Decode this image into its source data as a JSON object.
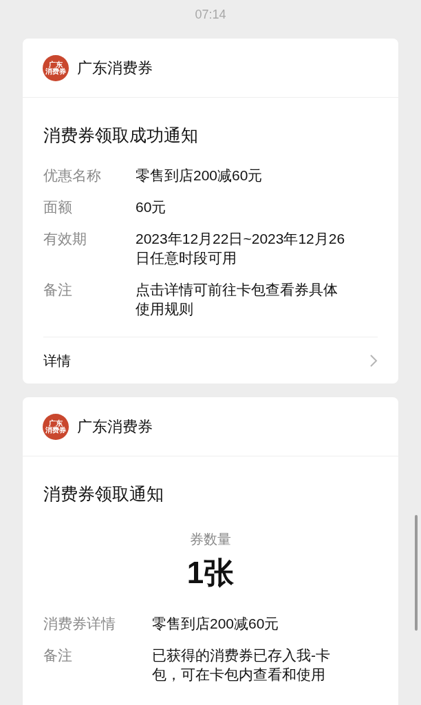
{
  "time": "07:14",
  "messages": [
    {
      "sender": {
        "name": "广东消费券",
        "avatar_text": [
          "广东",
          "消费券"
        ]
      },
      "title": "消费券领取成功通知",
      "rows": [
        {
          "label": "优惠名称",
          "value": "零售到店200减60元"
        },
        {
          "label": "面额",
          "value": "60元"
        },
        {
          "label": "有效期",
          "value": "2023年12月22日~2023年12月26日任意时段可用"
        },
        {
          "label": "备注",
          "value": "点击详情可前往卡包查看券具体使用规则"
        }
      ],
      "footer": {
        "label": "详情"
      }
    },
    {
      "sender": {
        "name": "广东消费券",
        "avatar_text": [
          "广东",
          "消费券"
        ]
      },
      "title": "消费券领取通知",
      "highlight": {
        "label": "券数量",
        "value": "1张"
      },
      "rows": [
        {
          "label": "消费券详情",
          "value": "零售到店200减60元"
        },
        {
          "label": "备注",
          "value": "已获得的消费券已存入我-卡包，可在卡包内查看和使用"
        }
      ]
    }
  ]
}
